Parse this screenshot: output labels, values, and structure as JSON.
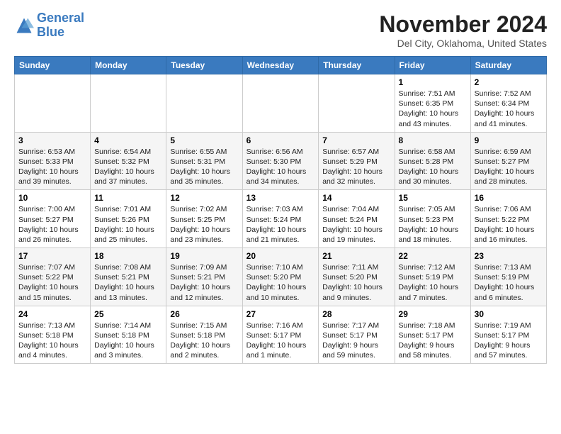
{
  "header": {
    "logo_line1": "General",
    "logo_line2": "Blue",
    "month": "November 2024",
    "location": "Del City, Oklahoma, United States"
  },
  "weekdays": [
    "Sunday",
    "Monday",
    "Tuesday",
    "Wednesday",
    "Thursday",
    "Friday",
    "Saturday"
  ],
  "weeks": [
    [
      {
        "day": "",
        "info": ""
      },
      {
        "day": "",
        "info": ""
      },
      {
        "day": "",
        "info": ""
      },
      {
        "day": "",
        "info": ""
      },
      {
        "day": "",
        "info": ""
      },
      {
        "day": "1",
        "info": "Sunrise: 7:51 AM\nSunset: 6:35 PM\nDaylight: 10 hours and 43 minutes."
      },
      {
        "day": "2",
        "info": "Sunrise: 7:52 AM\nSunset: 6:34 PM\nDaylight: 10 hours and 41 minutes."
      }
    ],
    [
      {
        "day": "3",
        "info": "Sunrise: 6:53 AM\nSunset: 5:33 PM\nDaylight: 10 hours and 39 minutes."
      },
      {
        "day": "4",
        "info": "Sunrise: 6:54 AM\nSunset: 5:32 PM\nDaylight: 10 hours and 37 minutes."
      },
      {
        "day": "5",
        "info": "Sunrise: 6:55 AM\nSunset: 5:31 PM\nDaylight: 10 hours and 35 minutes."
      },
      {
        "day": "6",
        "info": "Sunrise: 6:56 AM\nSunset: 5:30 PM\nDaylight: 10 hours and 34 minutes."
      },
      {
        "day": "7",
        "info": "Sunrise: 6:57 AM\nSunset: 5:29 PM\nDaylight: 10 hours and 32 minutes."
      },
      {
        "day": "8",
        "info": "Sunrise: 6:58 AM\nSunset: 5:28 PM\nDaylight: 10 hours and 30 minutes."
      },
      {
        "day": "9",
        "info": "Sunrise: 6:59 AM\nSunset: 5:27 PM\nDaylight: 10 hours and 28 minutes."
      }
    ],
    [
      {
        "day": "10",
        "info": "Sunrise: 7:00 AM\nSunset: 5:27 PM\nDaylight: 10 hours and 26 minutes."
      },
      {
        "day": "11",
        "info": "Sunrise: 7:01 AM\nSunset: 5:26 PM\nDaylight: 10 hours and 25 minutes."
      },
      {
        "day": "12",
        "info": "Sunrise: 7:02 AM\nSunset: 5:25 PM\nDaylight: 10 hours and 23 minutes."
      },
      {
        "day": "13",
        "info": "Sunrise: 7:03 AM\nSunset: 5:24 PM\nDaylight: 10 hours and 21 minutes."
      },
      {
        "day": "14",
        "info": "Sunrise: 7:04 AM\nSunset: 5:24 PM\nDaylight: 10 hours and 19 minutes."
      },
      {
        "day": "15",
        "info": "Sunrise: 7:05 AM\nSunset: 5:23 PM\nDaylight: 10 hours and 18 minutes."
      },
      {
        "day": "16",
        "info": "Sunrise: 7:06 AM\nSunset: 5:22 PM\nDaylight: 10 hours and 16 minutes."
      }
    ],
    [
      {
        "day": "17",
        "info": "Sunrise: 7:07 AM\nSunset: 5:22 PM\nDaylight: 10 hours and 15 minutes."
      },
      {
        "day": "18",
        "info": "Sunrise: 7:08 AM\nSunset: 5:21 PM\nDaylight: 10 hours and 13 minutes."
      },
      {
        "day": "19",
        "info": "Sunrise: 7:09 AM\nSunset: 5:21 PM\nDaylight: 10 hours and 12 minutes."
      },
      {
        "day": "20",
        "info": "Sunrise: 7:10 AM\nSunset: 5:20 PM\nDaylight: 10 hours and 10 minutes."
      },
      {
        "day": "21",
        "info": "Sunrise: 7:11 AM\nSunset: 5:20 PM\nDaylight: 10 hours and 9 minutes."
      },
      {
        "day": "22",
        "info": "Sunrise: 7:12 AM\nSunset: 5:19 PM\nDaylight: 10 hours and 7 minutes."
      },
      {
        "day": "23",
        "info": "Sunrise: 7:13 AM\nSunset: 5:19 PM\nDaylight: 10 hours and 6 minutes."
      }
    ],
    [
      {
        "day": "24",
        "info": "Sunrise: 7:13 AM\nSunset: 5:18 PM\nDaylight: 10 hours and 4 minutes."
      },
      {
        "day": "25",
        "info": "Sunrise: 7:14 AM\nSunset: 5:18 PM\nDaylight: 10 hours and 3 minutes."
      },
      {
        "day": "26",
        "info": "Sunrise: 7:15 AM\nSunset: 5:18 PM\nDaylight: 10 hours and 2 minutes."
      },
      {
        "day": "27",
        "info": "Sunrise: 7:16 AM\nSunset: 5:17 PM\nDaylight: 10 hours and 1 minute."
      },
      {
        "day": "28",
        "info": "Sunrise: 7:17 AM\nSunset: 5:17 PM\nDaylight: 9 hours and 59 minutes."
      },
      {
        "day": "29",
        "info": "Sunrise: 7:18 AM\nSunset: 5:17 PM\nDaylight: 9 hours and 58 minutes."
      },
      {
        "day": "30",
        "info": "Sunrise: 7:19 AM\nSunset: 5:17 PM\nDaylight: 9 hours and 57 minutes."
      }
    ]
  ]
}
